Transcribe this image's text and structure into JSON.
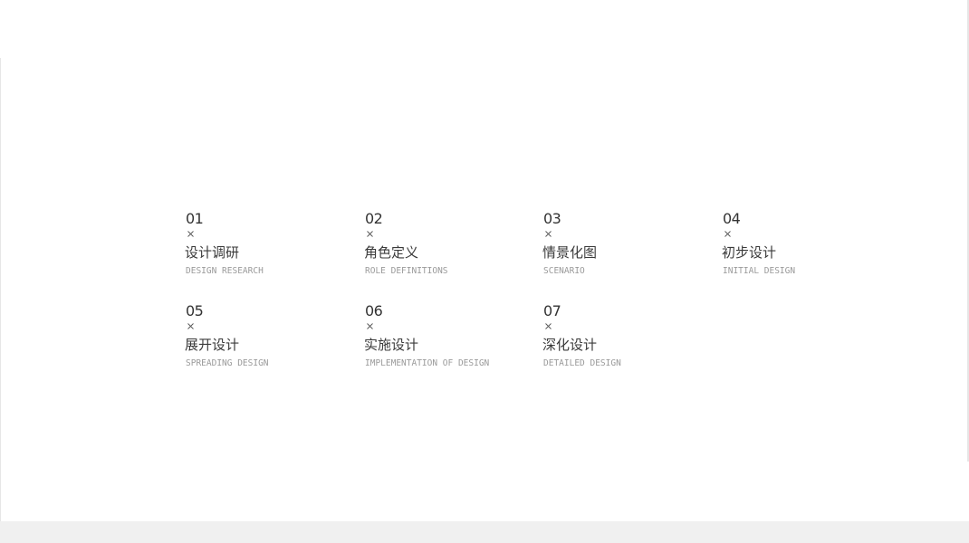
{
  "sections": [
    {
      "number": "01",
      "title_zh": "设计调研",
      "title_en": "DESIGN RESEARCH"
    },
    {
      "number": "02",
      "title_zh": "角色定义",
      "title_en": "ROLE DEFINITIONS"
    },
    {
      "number": "03",
      "title_zh": "情景化图",
      "title_en": "SCENARIO"
    },
    {
      "number": "04",
      "title_zh": "初步设计",
      "title_en": "INITIAL DESIGN"
    },
    {
      "number": "05",
      "title_zh": "展开设计",
      "title_en": "SPREADING DESIGN"
    },
    {
      "number": "06",
      "title_zh": "实施设计",
      "title_en": "IMPLEMENTATION OF DESIGN"
    },
    {
      "number": "07",
      "title_zh": "深化设计",
      "title_en": "DETAILED DESIGN"
    }
  ],
  "icons": {
    "separator": "close-icon"
  },
  "colors": {
    "number": "#333333",
    "title_zh": "#3a3a3a",
    "title_en": "#9a9a9a",
    "background": "#ffffff",
    "footer": "#f0f0f0"
  }
}
